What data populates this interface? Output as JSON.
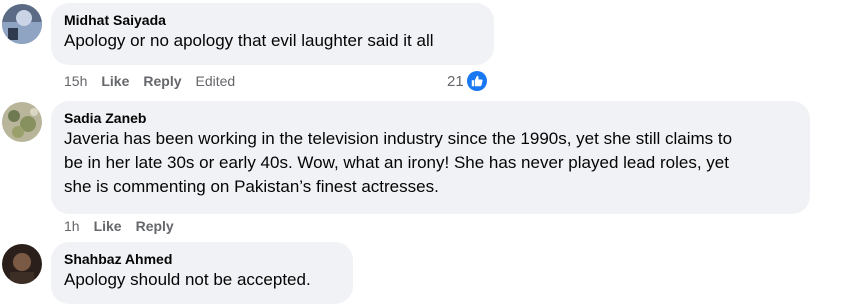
{
  "comments": [
    {
      "author": "Midhat Saiyada",
      "text": "Apology or no apology that evil laughter said it all",
      "time": "15h",
      "like_label": "Like",
      "reply_label": "Reply",
      "edited_label": "Edited",
      "reaction_count": "21",
      "reaction_icon": "like-icon"
    },
    {
      "author": "Sadia Zaneb",
      "text_lines": [
        "Javeria has been working in the television industry since the 1990s, yet she still claims to",
        "be in her late 30s or early 40s. Wow, what an irony! She has never played lead roles, yet",
        "she is commenting on Pakistan’s finest actresses."
      ],
      "time": "1h",
      "like_label": "Like",
      "reply_label": "Reply"
    },
    {
      "author": "Shahbaz Ahmed",
      "text": "Apology should not be accepted."
    }
  ],
  "colors": {
    "bubble": "#f0f2f5",
    "meta_text": "#65676b",
    "like_blue": "#1877f2"
  }
}
